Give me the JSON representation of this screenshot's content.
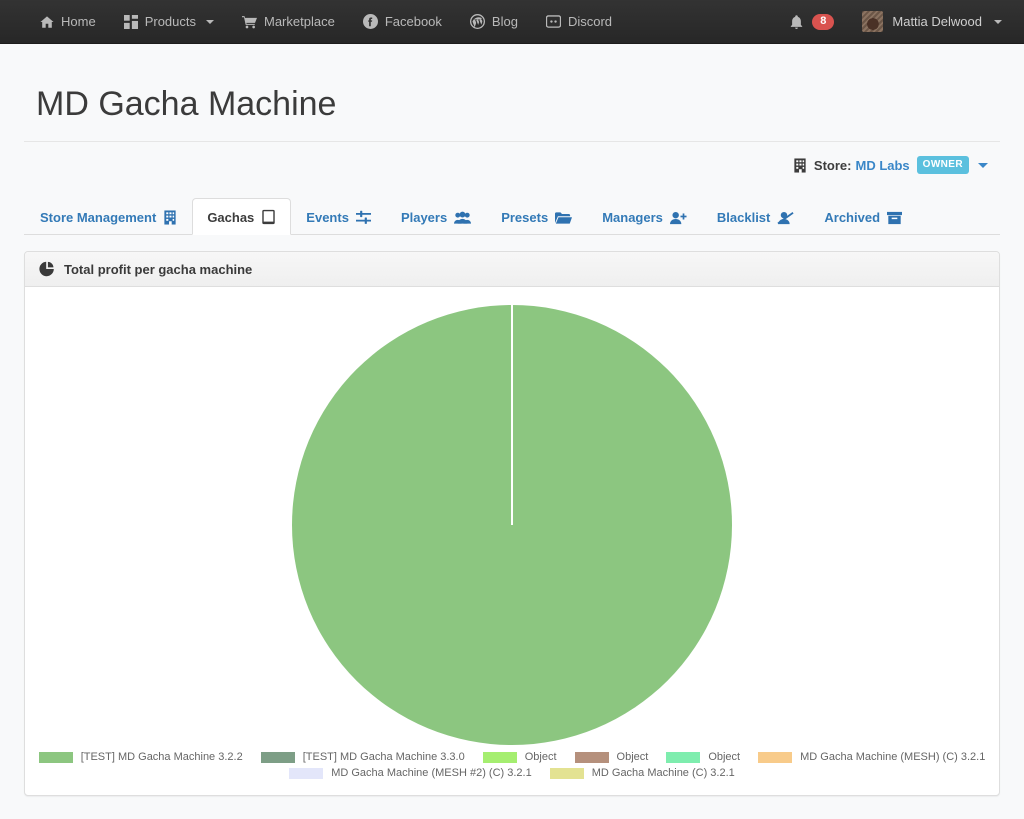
{
  "navbar": {
    "left_items": [
      {
        "label": "Home",
        "icon": "home-icon"
      },
      {
        "label": "Products",
        "icon": "grid-icon",
        "has_caret": true
      },
      {
        "label": "Marketplace",
        "icon": "cart-icon"
      },
      {
        "label": "Facebook",
        "icon": "facebook-icon"
      },
      {
        "label": "Blog",
        "icon": "wordpress-icon"
      },
      {
        "label": "Discord",
        "icon": "discord-icon"
      }
    ],
    "notifications": {
      "icon": "bell-icon",
      "count": "8"
    },
    "user": {
      "name": "Mattia Delwood",
      "avatar": "user-avatar"
    }
  },
  "header": {
    "title": "MD Gacha Machine"
  },
  "store": {
    "icon": "building-icon",
    "label": "Store:",
    "name": "MD Labs",
    "role_badge": "OWNER"
  },
  "tabs": [
    {
      "label": "Store Management",
      "icon": "building-icon",
      "active": false
    },
    {
      "label": "Gachas",
      "icon": "tablet-icon",
      "active": true
    },
    {
      "label": "Events",
      "icon": "sliders-icon",
      "active": false
    },
    {
      "label": "Players",
      "icon": "users-icon",
      "active": false
    },
    {
      "label": "Presets",
      "icon": "folder-open-icon",
      "active": false
    },
    {
      "label": "Managers",
      "icon": "user-plus-icon",
      "active": false
    },
    {
      "label": "Blacklist",
      "icon": "user-slash-icon",
      "active": false
    },
    {
      "label": "Archived",
      "icon": "archive-icon",
      "active": false
    }
  ],
  "panel": {
    "icon": "pie-chart-icon",
    "title": "Total profit per gacha machine"
  },
  "chart_data": {
    "type": "pie",
    "title": "Total profit per gacha machine",
    "legend_position": "bottom",
    "categories": [
      "[TEST] MD Gacha Machine 3.2.2",
      "[TEST] MD Gacha Machine 3.3.0",
      "Object",
      "Object",
      "Object",
      "MD Gacha Machine (MESH) (C) 3.2.1",
      "MD Gacha Machine (MESH #2) (C) 3.2.1",
      "MD Gacha Machine (C)  3.2.1"
    ],
    "values": [
      100,
      0,
      0,
      0,
      0,
      0,
      0,
      0
    ],
    "colors": [
      "#8cc680",
      "#7d9e86",
      "#a5ee70",
      "#b5907c",
      "#7eedae",
      "#f8cb8a",
      "#e3e6fa",
      "#e3e292"
    ]
  }
}
